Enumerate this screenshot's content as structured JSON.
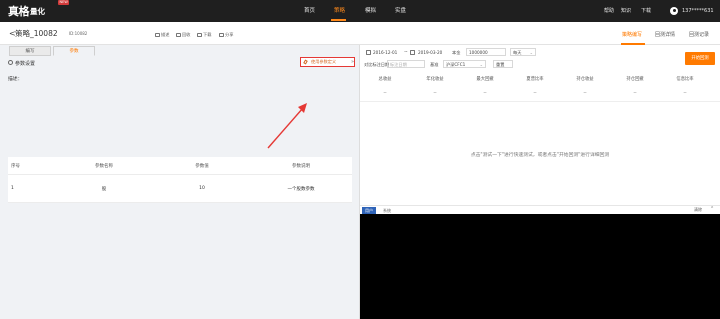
{
  "nav": {
    "logo_main": "真格",
    "logo_sub": "量化",
    "logo_badge": "NEW",
    "items": [
      "首页",
      "策略",
      "模拟",
      "实盘"
    ],
    "right": [
      "帮助",
      "知识",
      "下载"
    ],
    "user": "137*****631"
  },
  "header": {
    "back": "<",
    "name": "策略_10082",
    "id": "ID:10082",
    "tools": [
      "描述",
      "回收",
      "下载",
      "分享"
    ],
    "tabs": [
      "策略编写",
      "回测详情",
      "回测记录"
    ]
  },
  "left": {
    "tabs": [
      "编写",
      "参数"
    ],
    "param_settings": "参数设置",
    "custom_btn": "使用参数定义",
    "desc_label": "描述：",
    "table": {
      "headers": [
        "序号",
        "参数名称",
        "参数值",
        "参数说明"
      ],
      "rows": [
        [
          "1",
          "股",
          "10",
          "一个股数参数"
        ]
      ]
    }
  },
  "right": {
    "start_date": "2016-12-01",
    "tilde": "~",
    "end_date": "2019-03-20",
    "capital_label": "本金",
    "capital": "1000000",
    "freq": "每天",
    "compare_label": "对比标注日期",
    "date_placeholder": "标注日期",
    "benchmark_label": "基准",
    "benchmark": "沪深CFC1",
    "reset": "重置",
    "run_btn": "开始回测",
    "stats_headers": [
      "总收益",
      "年化收益",
      "最大回撤",
      "夏普比率",
      "持仓收益",
      "持仓回撤",
      "信息比率"
    ],
    "stats_values": [
      "--",
      "--",
      "--",
      "--",
      "--",
      "--",
      "--"
    ],
    "hint": "点击\"测试一下\"进行快速测试，或者点击\"开始回测\"进行详细回测",
    "console_tabs": [
      "用户",
      "系统"
    ],
    "clear": "清除"
  },
  "colors": {
    "accent": "#ff7a00",
    "topbar": "#1f1f1f",
    "highlight": "#e53935",
    "console": "#000000"
  }
}
